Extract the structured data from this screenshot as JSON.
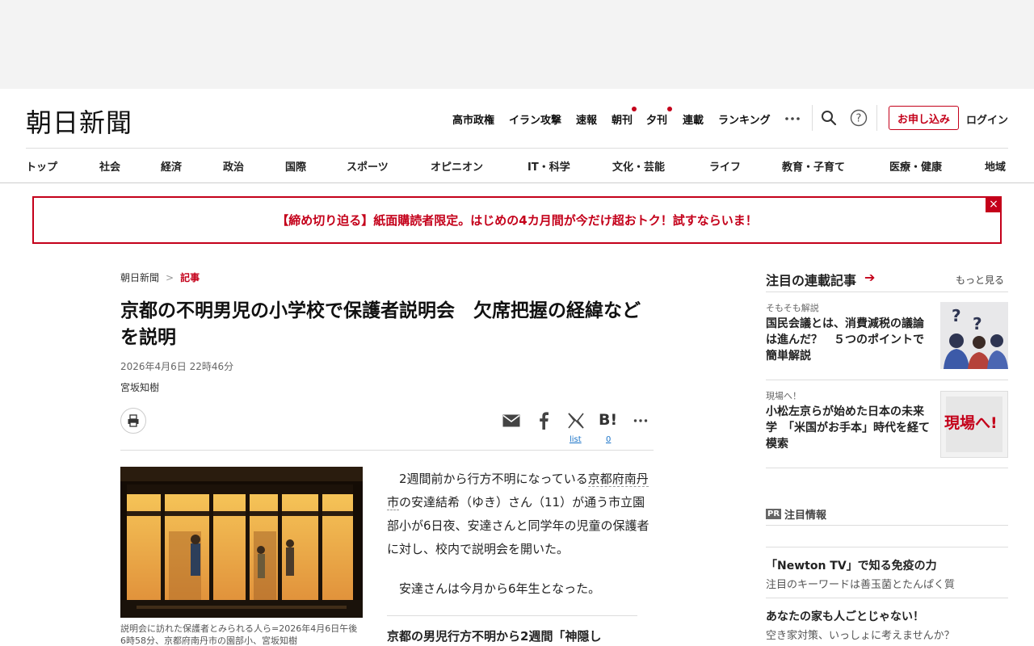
{
  "header": {
    "logo": "朝日新聞",
    "top_links": [
      "高市政権",
      "イラン攻撃",
      "速報",
      "朝刊",
      "夕刊",
      "連載",
      "ランキング"
    ],
    "more_icon": "ellipsis-icon",
    "search_icon": "search-icon",
    "help_icon": "help-icon",
    "apply_label": "お申し込み",
    "login_label": "ログイン",
    "accent_color": "#c4001a"
  },
  "categories": [
    "トップ",
    "社会",
    "経済",
    "政治",
    "国際",
    "スポーツ",
    "オピニオン",
    "IT・科学",
    "文化・芸能",
    "ライフ",
    "教育・子育て",
    "医療・健康",
    "地域"
  ],
  "banner": {
    "text": "【締め切り迫る】紙面購読者限定。はじめの4カ月間が今だけ超おトク！試すならいま！",
    "close": "×"
  },
  "article": {
    "breadcrumb_home": "朝日新聞",
    "breadcrumb_sep": ">",
    "breadcrumb_current": "記事",
    "headline": "京都の不明男児の小学校で保護者説明会　欠席把握の経緯などを説明",
    "date": "2026年4月6日 22時46分",
    "author": "宮坂知樹",
    "share": {
      "mail_icon": "mail-icon",
      "facebook_icon": "facebook-icon",
      "x_icon": "x-icon",
      "x_sub": "list",
      "hatena_label": "B!",
      "hatena_count": "0",
      "more_icon": "ellipsis-icon"
    },
    "caption": "説明会に訪れた保護者とみられる人ら=2026年4月6日午後6時58分、京都府南丹市の園部小、宮坂知樹",
    "p1_a": "2週間前から行方不明になっている",
    "p1_link": "京都府南丹市",
    "p1_b": "の安達結希（ゆき）さん（11）が通う市立園部小が6日夜、安達さんと同学年の児童の保護者に対し、校内で説明会を開いた。",
    "p2": "安達さんは今月から6年生となった。",
    "related": "京都の男児行方不明から2週間「神隠し"
  },
  "sidebar": {
    "title": "注目の連載記事",
    "arrow": "➔",
    "more": "もっと見る",
    "items": [
      {
        "kicker": "そもそも解説",
        "title": "国民会議とは、消費減税の議論は進んだ？　５つのポイントで簡単解説"
      },
      {
        "kicker": "現場へ！",
        "title": "小松左京らが始めた日本の未来学　「米国がお手本」時代を経て模索"
      }
    ],
    "thumb2_text": "現場へ!",
    "pr_badge": "PR",
    "pr_title": "注目情報",
    "pr_items": [
      {
        "title": "「Newton TV」で知る免疫の力",
        "sub": "注目のキーワードは善玉菌とたんぱく質"
      },
      {
        "title": "あなたの家も人ごとじゃない！",
        "sub": "空き家対策、いっしょに考えませんか？"
      }
    ]
  }
}
